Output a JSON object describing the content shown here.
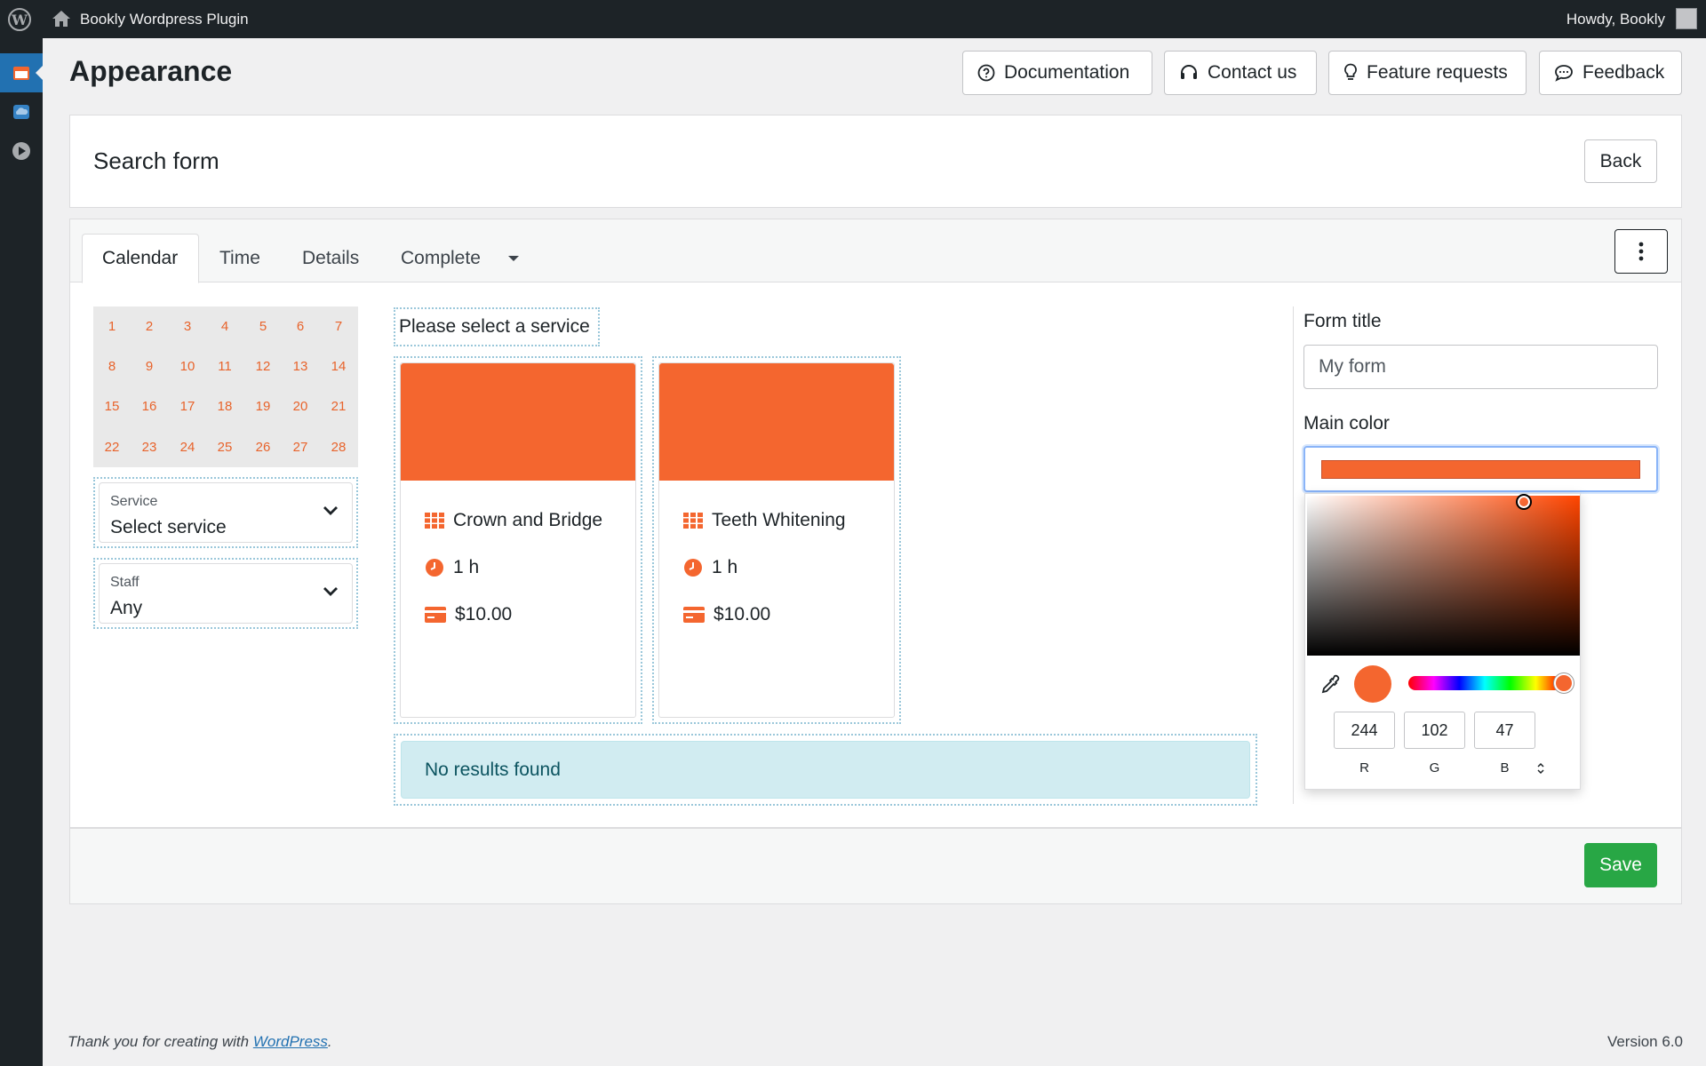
{
  "adminbar": {
    "site_name": "Bookly Wordpress Plugin",
    "howdy": "Howdy, Bookly"
  },
  "header": {
    "title": "Appearance",
    "buttons": {
      "documentation": "Documentation",
      "contact": "Contact us",
      "feature_requests": "Feature requests",
      "feedback": "Feedback"
    }
  },
  "section": {
    "title": "Search form",
    "back_label": "Back"
  },
  "tabs": [
    "Calendar",
    "Time",
    "Details",
    "Complete"
  ],
  "calendar": {
    "weeks": [
      [
        "1",
        "2",
        "3",
        "4",
        "5",
        "6",
        "7"
      ],
      [
        "8",
        "9",
        "10",
        "11",
        "12",
        "13",
        "14"
      ],
      [
        "15",
        "16",
        "17",
        "18",
        "19",
        "20",
        "21"
      ],
      [
        "22",
        "23",
        "24",
        "25",
        "26",
        "27",
        "28"
      ]
    ]
  },
  "filters": {
    "service": {
      "label": "Service",
      "value": "Select service"
    },
    "staff": {
      "label": "Staff",
      "value": "Any"
    }
  },
  "services": {
    "heading": "Please select a service",
    "cards": [
      {
        "name": "Crown and Bridge",
        "duration": "1 h",
        "price": "$10.00"
      },
      {
        "name": "Teeth Whitening",
        "duration": "1 h",
        "price": "$10.00"
      }
    ],
    "no_results": "No results found"
  },
  "settings": {
    "form_title_label": "Form title",
    "form_title_value": "My form",
    "main_color_label": "Main color",
    "color": "#f4662f",
    "rgb": {
      "r": "244",
      "g": "102",
      "b": "47"
    },
    "rgb_labels": {
      "r": "R",
      "g": "G",
      "b": "B"
    }
  },
  "save_label": "Save",
  "footer": {
    "thanks_prefix": "Thank you for creating with ",
    "link_text": "WordPress",
    "suffix": ".",
    "version": "Version 6.0"
  }
}
